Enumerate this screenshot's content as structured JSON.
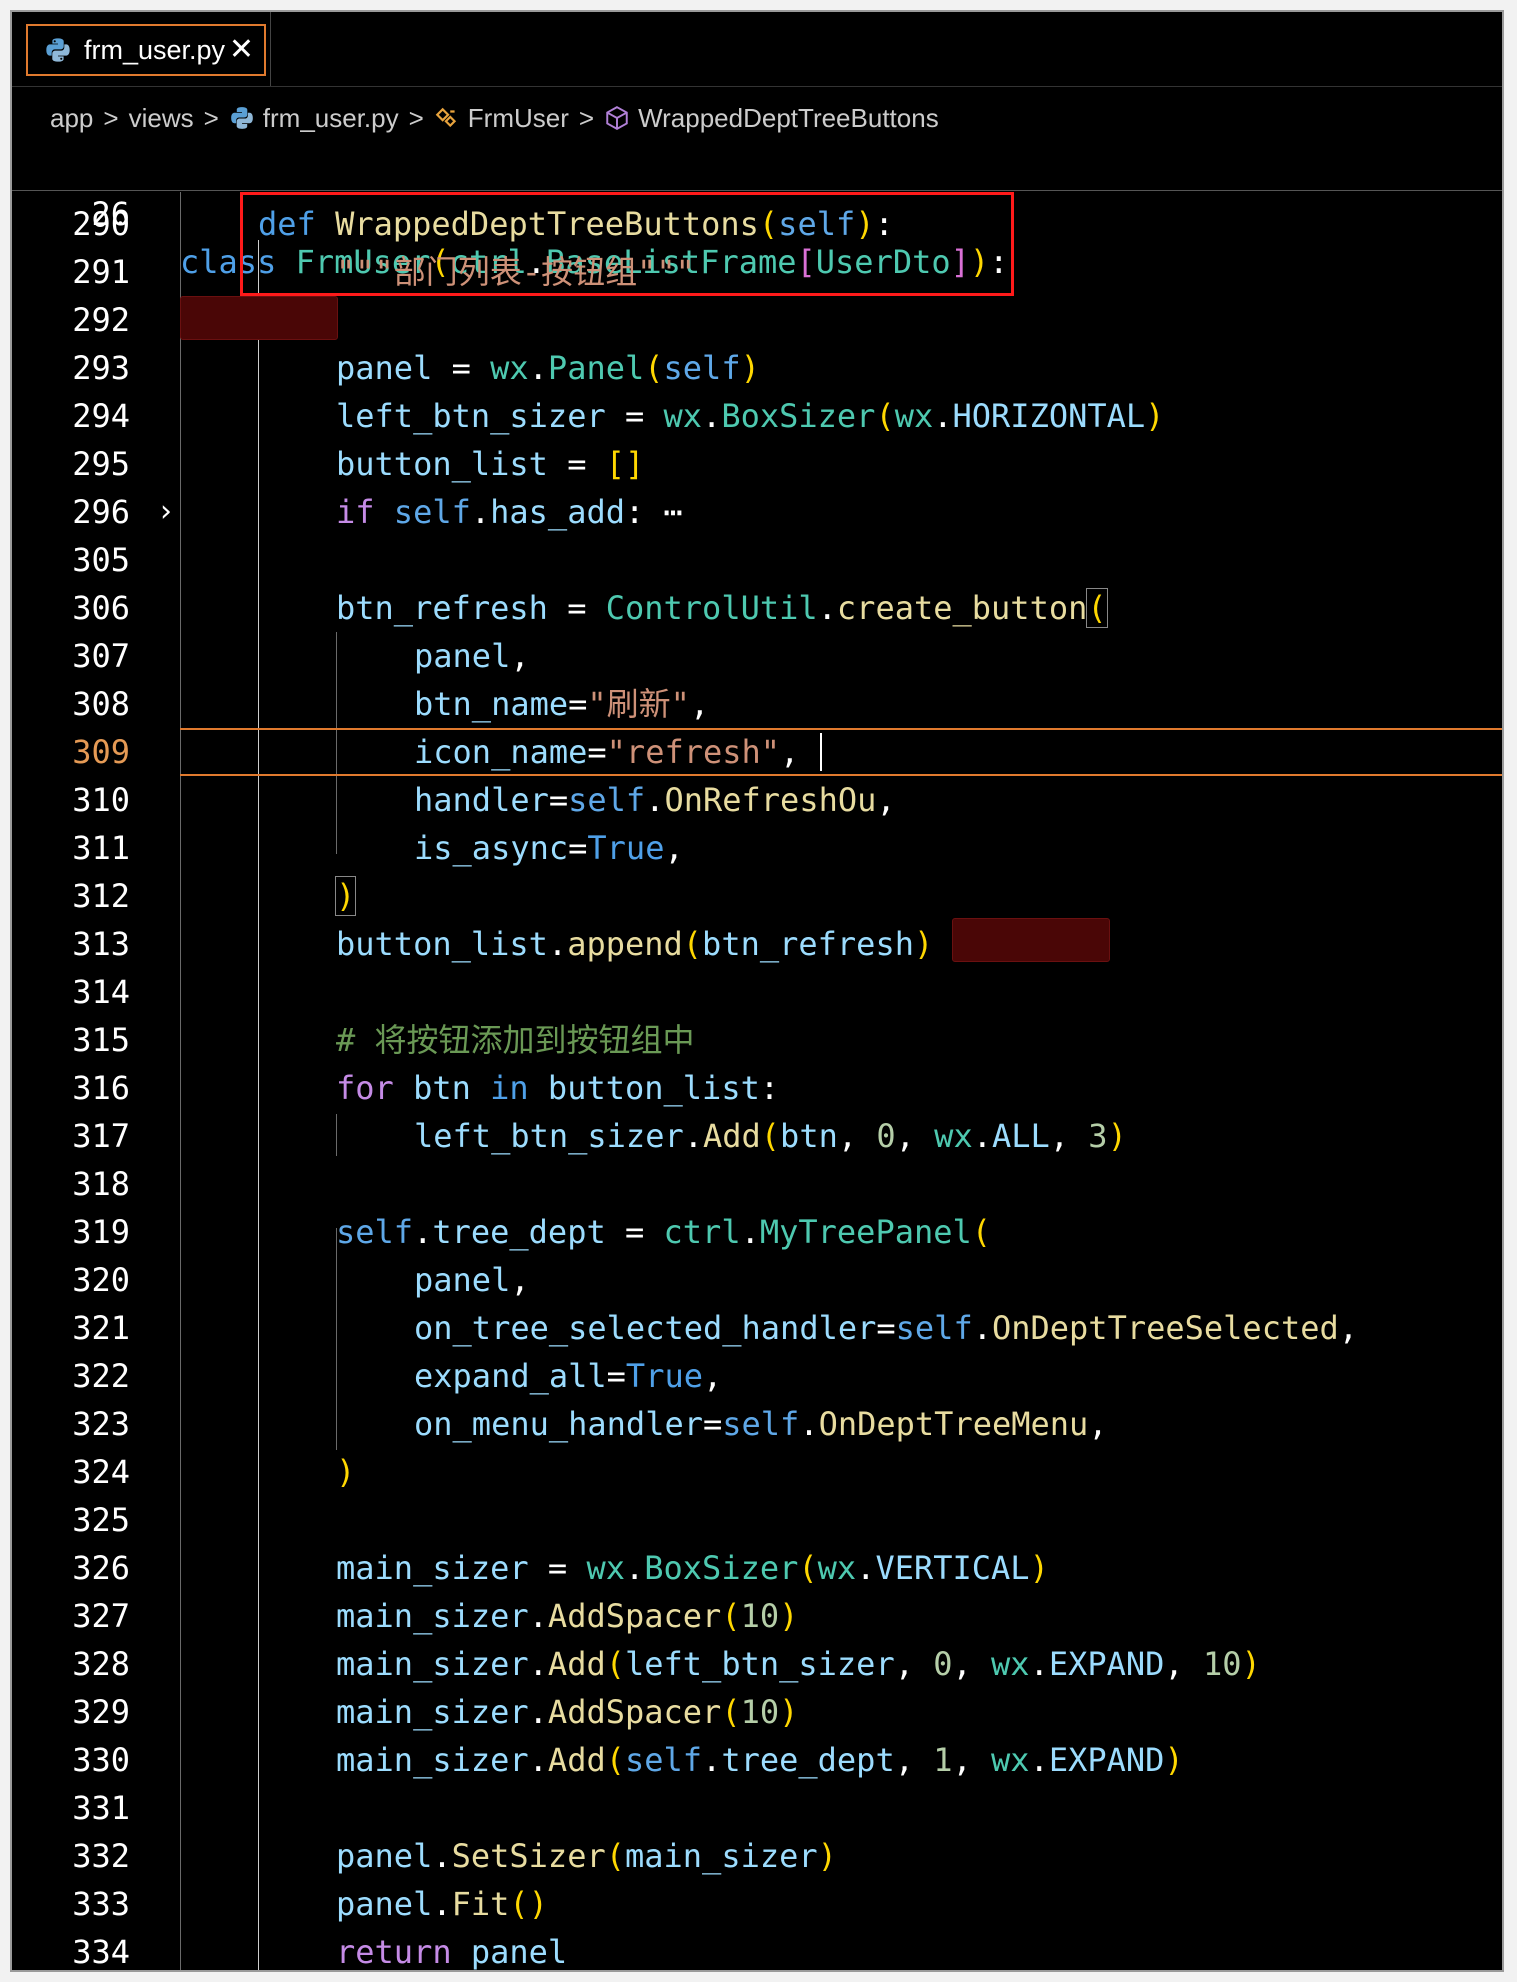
{
  "tab": {
    "title": "frm_user.py",
    "close_glyph": "✕",
    "icon": "python-file-icon"
  },
  "breadcrumb": {
    "items": [
      "app",
      "views",
      "frm_user.py",
      "FrmUser",
      "WrappedDeptTreeButtons"
    ],
    "separator": ">"
  },
  "sticky": {
    "line_no": "26"
  },
  "lines": [
    {
      "n": "290"
    },
    {
      "n": "291"
    },
    {
      "n": "292"
    },
    {
      "n": "293"
    },
    {
      "n": "294"
    },
    {
      "n": "295"
    },
    {
      "n": "296"
    },
    {
      "n": "305"
    },
    {
      "n": "306"
    },
    {
      "n": "307"
    },
    {
      "n": "308"
    },
    {
      "n": "309"
    },
    {
      "n": "310"
    },
    {
      "n": "311"
    },
    {
      "n": "312"
    },
    {
      "n": "313"
    },
    {
      "n": "314"
    },
    {
      "n": "315"
    },
    {
      "n": "316"
    },
    {
      "n": "317"
    },
    {
      "n": "318"
    },
    {
      "n": "319"
    },
    {
      "n": "320"
    },
    {
      "n": "321"
    },
    {
      "n": "322"
    },
    {
      "n": "323"
    },
    {
      "n": "324"
    },
    {
      "n": "325"
    },
    {
      "n": "326"
    },
    {
      "n": "327"
    },
    {
      "n": "328"
    },
    {
      "n": "329"
    },
    {
      "n": "330"
    },
    {
      "n": "331"
    },
    {
      "n": "332"
    },
    {
      "n": "333"
    },
    {
      "n": "334"
    }
  ],
  "current_line": "309",
  "colors": {
    "accent": "#e07a2e",
    "highlight_box": "#ff1a1a",
    "error_mark": "#4a0606",
    "keyword": "#4fa0e8",
    "string": "#ce9178",
    "comment": "#6a9955"
  }
}
